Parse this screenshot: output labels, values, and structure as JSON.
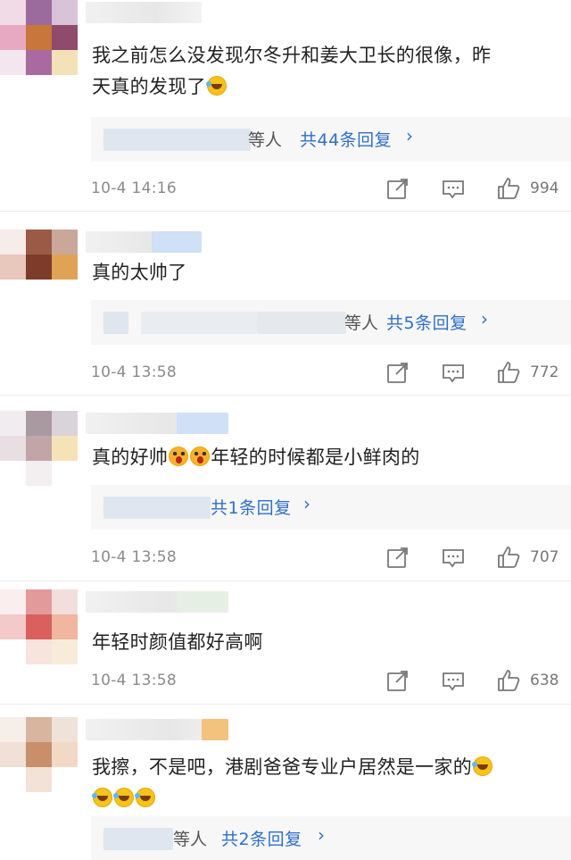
{
  "icons": {
    "share": "share-icon",
    "comment": "comment-icon",
    "like": "thumbs-up-icon"
  },
  "colors": {
    "accent": "#2f6fc9",
    "time": "#8a8a8a",
    "text": "#222222"
  },
  "comments": [
    {
      "text_lines": [
        "我之前怎么没发现尔冬升和姜大卫长的很像，昨",
        "天真的发现了"
      ],
      "emoji": [
        "laughing-tears-emoji"
      ],
      "reply_suffix": "等人",
      "reply_count": "共44条回复",
      "time": "10-4 14:16",
      "likes": "994"
    },
    {
      "text_lines": [
        "真的太帅了"
      ],
      "reply_suffix": "等人",
      "reply_count": "共5条回复",
      "time": "10-4 13:58",
      "likes": "772"
    },
    {
      "text_lines": [
        "真的好帅",
        "年轻的时候都是小鲜肉的"
      ],
      "emoji": [
        "astonished-emoji",
        "astonished-emoji"
      ],
      "reply_count": "共1条回复",
      "time": "10-4 13:58",
      "likes": "707"
    },
    {
      "text_lines": [
        "年轻时颜值都好高啊"
      ],
      "time": "10-4 13:58",
      "likes": "638"
    },
    {
      "text_lines": [
        "我擦，不是吧，港剧爸爸专业户居然是一家的"
      ],
      "emoji": [
        "laughing-tears-emoji",
        "laughing-tears-emoji",
        "laughing-tears-emoji",
        "laughing-tears-emoji"
      ],
      "reply_suffix": "等人",
      "reply_count": "共2条回复"
    }
  ]
}
